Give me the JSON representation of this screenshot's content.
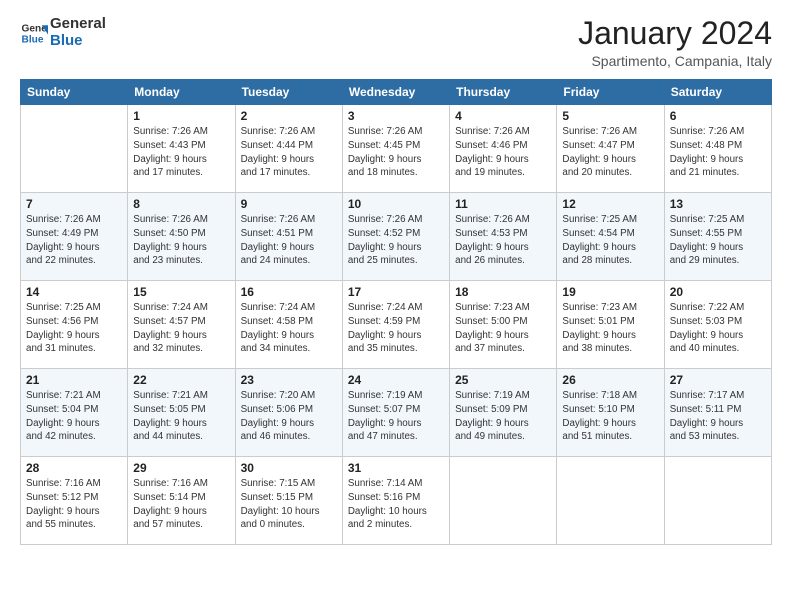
{
  "logo": {
    "line1": "General",
    "line2": "Blue"
  },
  "title": "January 2024",
  "subtitle": "Spartimento, Campania, Italy",
  "weekdays": [
    "Sunday",
    "Monday",
    "Tuesday",
    "Wednesday",
    "Thursday",
    "Friday",
    "Saturday"
  ],
  "weeks": [
    [
      {
        "num": "",
        "info": ""
      },
      {
        "num": "1",
        "info": "Sunrise: 7:26 AM\nSunset: 4:43 PM\nDaylight: 9 hours\nand 17 minutes."
      },
      {
        "num": "2",
        "info": "Sunrise: 7:26 AM\nSunset: 4:44 PM\nDaylight: 9 hours\nand 17 minutes."
      },
      {
        "num": "3",
        "info": "Sunrise: 7:26 AM\nSunset: 4:45 PM\nDaylight: 9 hours\nand 18 minutes."
      },
      {
        "num": "4",
        "info": "Sunrise: 7:26 AM\nSunset: 4:46 PM\nDaylight: 9 hours\nand 19 minutes."
      },
      {
        "num": "5",
        "info": "Sunrise: 7:26 AM\nSunset: 4:47 PM\nDaylight: 9 hours\nand 20 minutes."
      },
      {
        "num": "6",
        "info": "Sunrise: 7:26 AM\nSunset: 4:48 PM\nDaylight: 9 hours\nand 21 minutes."
      }
    ],
    [
      {
        "num": "7",
        "info": "Sunrise: 7:26 AM\nSunset: 4:49 PM\nDaylight: 9 hours\nand 22 minutes."
      },
      {
        "num": "8",
        "info": "Sunrise: 7:26 AM\nSunset: 4:50 PM\nDaylight: 9 hours\nand 23 minutes."
      },
      {
        "num": "9",
        "info": "Sunrise: 7:26 AM\nSunset: 4:51 PM\nDaylight: 9 hours\nand 24 minutes."
      },
      {
        "num": "10",
        "info": "Sunrise: 7:26 AM\nSunset: 4:52 PM\nDaylight: 9 hours\nand 25 minutes."
      },
      {
        "num": "11",
        "info": "Sunrise: 7:26 AM\nSunset: 4:53 PM\nDaylight: 9 hours\nand 26 minutes."
      },
      {
        "num": "12",
        "info": "Sunrise: 7:25 AM\nSunset: 4:54 PM\nDaylight: 9 hours\nand 28 minutes."
      },
      {
        "num": "13",
        "info": "Sunrise: 7:25 AM\nSunset: 4:55 PM\nDaylight: 9 hours\nand 29 minutes."
      }
    ],
    [
      {
        "num": "14",
        "info": "Sunrise: 7:25 AM\nSunset: 4:56 PM\nDaylight: 9 hours\nand 31 minutes."
      },
      {
        "num": "15",
        "info": "Sunrise: 7:24 AM\nSunset: 4:57 PM\nDaylight: 9 hours\nand 32 minutes."
      },
      {
        "num": "16",
        "info": "Sunrise: 7:24 AM\nSunset: 4:58 PM\nDaylight: 9 hours\nand 34 minutes."
      },
      {
        "num": "17",
        "info": "Sunrise: 7:24 AM\nSunset: 4:59 PM\nDaylight: 9 hours\nand 35 minutes."
      },
      {
        "num": "18",
        "info": "Sunrise: 7:23 AM\nSunset: 5:00 PM\nDaylight: 9 hours\nand 37 minutes."
      },
      {
        "num": "19",
        "info": "Sunrise: 7:23 AM\nSunset: 5:01 PM\nDaylight: 9 hours\nand 38 minutes."
      },
      {
        "num": "20",
        "info": "Sunrise: 7:22 AM\nSunset: 5:03 PM\nDaylight: 9 hours\nand 40 minutes."
      }
    ],
    [
      {
        "num": "21",
        "info": "Sunrise: 7:21 AM\nSunset: 5:04 PM\nDaylight: 9 hours\nand 42 minutes."
      },
      {
        "num": "22",
        "info": "Sunrise: 7:21 AM\nSunset: 5:05 PM\nDaylight: 9 hours\nand 44 minutes."
      },
      {
        "num": "23",
        "info": "Sunrise: 7:20 AM\nSunset: 5:06 PM\nDaylight: 9 hours\nand 46 minutes."
      },
      {
        "num": "24",
        "info": "Sunrise: 7:19 AM\nSunset: 5:07 PM\nDaylight: 9 hours\nand 47 minutes."
      },
      {
        "num": "25",
        "info": "Sunrise: 7:19 AM\nSunset: 5:09 PM\nDaylight: 9 hours\nand 49 minutes."
      },
      {
        "num": "26",
        "info": "Sunrise: 7:18 AM\nSunset: 5:10 PM\nDaylight: 9 hours\nand 51 minutes."
      },
      {
        "num": "27",
        "info": "Sunrise: 7:17 AM\nSunset: 5:11 PM\nDaylight: 9 hours\nand 53 minutes."
      }
    ],
    [
      {
        "num": "28",
        "info": "Sunrise: 7:16 AM\nSunset: 5:12 PM\nDaylight: 9 hours\nand 55 minutes."
      },
      {
        "num": "29",
        "info": "Sunrise: 7:16 AM\nSunset: 5:14 PM\nDaylight: 9 hours\nand 57 minutes."
      },
      {
        "num": "30",
        "info": "Sunrise: 7:15 AM\nSunset: 5:15 PM\nDaylight: 10 hours\nand 0 minutes."
      },
      {
        "num": "31",
        "info": "Sunrise: 7:14 AM\nSunset: 5:16 PM\nDaylight: 10 hours\nand 2 minutes."
      },
      {
        "num": "",
        "info": ""
      },
      {
        "num": "",
        "info": ""
      },
      {
        "num": "",
        "info": ""
      }
    ]
  ]
}
